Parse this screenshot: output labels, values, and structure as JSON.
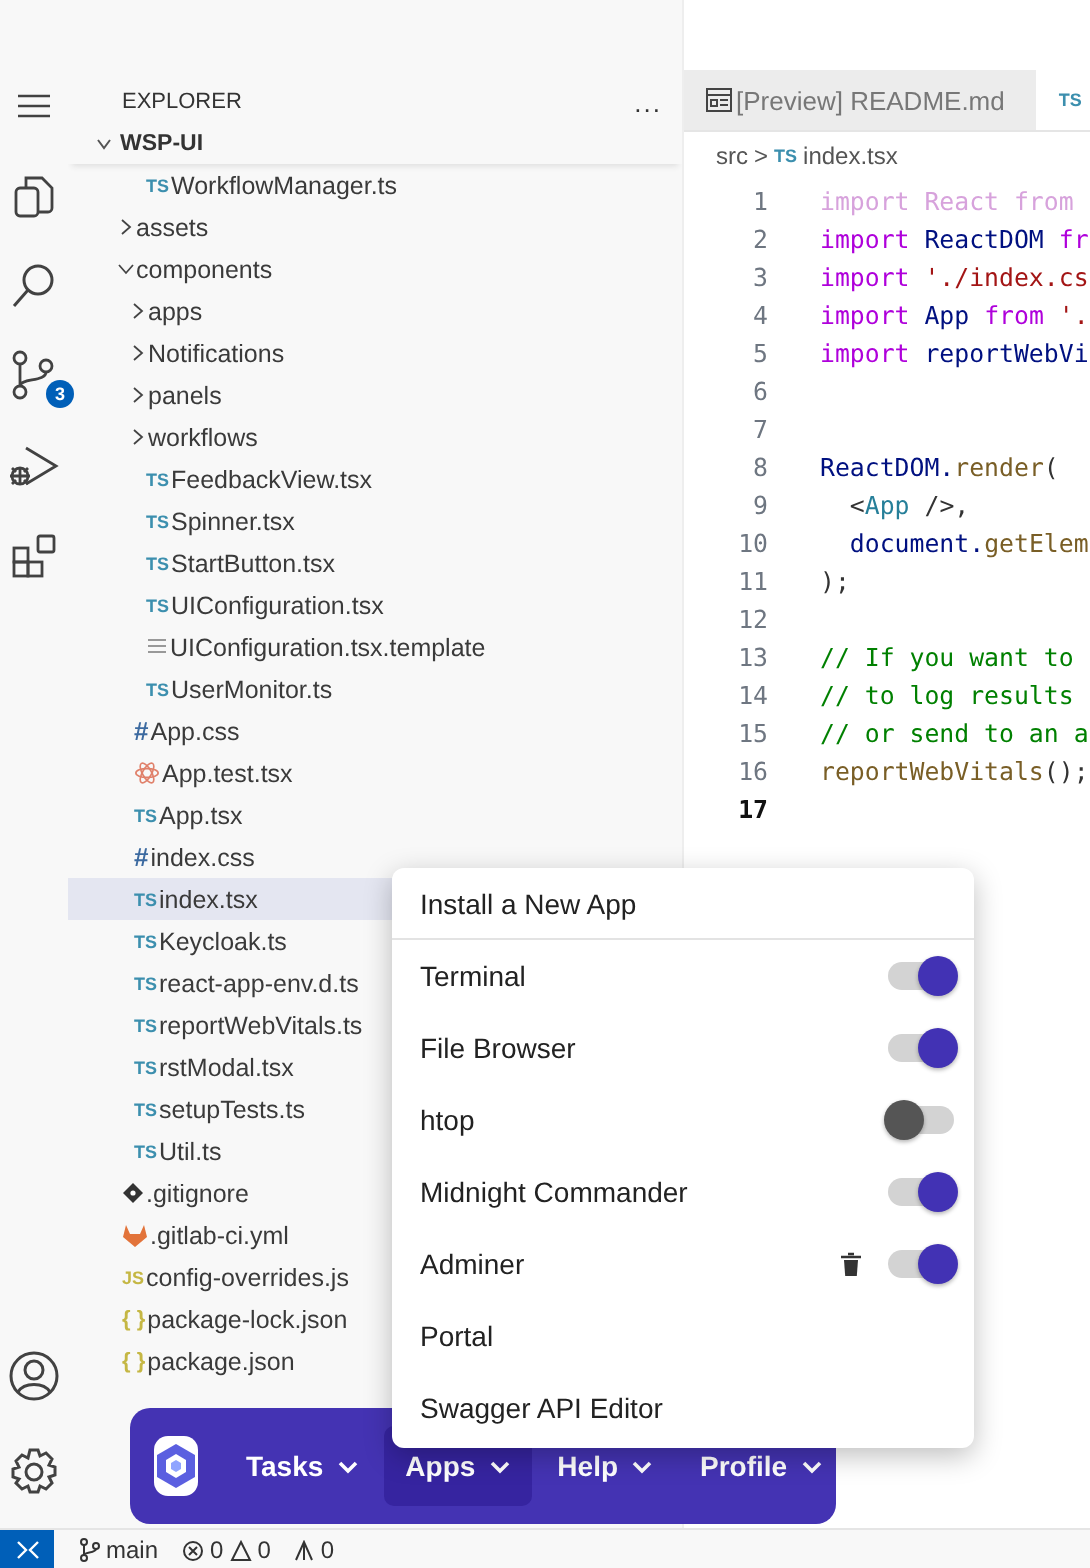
{
  "activity_bar": {
    "items": [
      {
        "kind": "menu"
      },
      {
        "kind": "files"
      },
      {
        "kind": "search"
      },
      {
        "kind": "source-control",
        "badge": "3"
      },
      {
        "kind": "debug"
      },
      {
        "kind": "extensions"
      }
    ],
    "bottom_items": [
      {
        "kind": "account"
      },
      {
        "kind": "settings"
      }
    ]
  },
  "sidebar": {
    "title": "EXPLORER",
    "more": "...",
    "root": {
      "label": "WSP-UI",
      "expanded": true
    },
    "tree": [
      {
        "children": [
          {
            "children": [
              {
                "label": "WorkflowManager.ts",
                "kind": "ts",
                "icon": "TS"
              }
            ]
          },
          {
            "label": "assets",
            "kind": "folder",
            "expanded": false
          },
          {
            "label": "components",
            "kind": "folder",
            "expanded": true,
            "children": [
              {
                "label": "apps",
                "kind": "folder",
                "expanded": false
              },
              {
                "label": "Notifications",
                "kind": "folder",
                "expanded": false
              },
              {
                "label": "panels",
                "kind": "folder",
                "expanded": false
              },
              {
                "label": "workflows",
                "kind": "folder",
                "expanded": false
              },
              {
                "label": "FeedbackView.tsx",
                "kind": "ts",
                "icon": "TS"
              },
              {
                "label": "Spinner.tsx",
                "kind": "ts",
                "icon": "TS"
              },
              {
                "label": "StartButton.tsx",
                "kind": "ts",
                "icon": "TS"
              },
              {
                "label": "UIConfiguration.tsx",
                "kind": "ts",
                "icon": "TS"
              },
              {
                "label": "UIConfiguration.tsx.template",
                "kind": "template"
              },
              {
                "label": "UserMonitor.ts",
                "kind": "ts",
                "icon": "TS"
              }
            ]
          },
          {
            "label": "App.css",
            "kind": "css",
            "icon": "#"
          },
          {
            "label": "App.test.tsx",
            "kind": "react"
          },
          {
            "label": "App.tsx",
            "kind": "ts",
            "icon": "TS"
          },
          {
            "label": "index.css",
            "kind": "css",
            "icon": "#"
          },
          {
            "label": "index.tsx",
            "kind": "ts",
            "icon": "TS",
            "selected": true
          },
          {
            "label": "Keycloak.ts",
            "kind": "ts",
            "icon": "TS"
          },
          {
            "label": "react-app-env.d.ts",
            "kind": "ts",
            "icon": "TS"
          },
          {
            "label": "reportWebVitals.ts",
            "kind": "ts",
            "icon": "TS"
          },
          {
            "label": "rstModal.tsx",
            "kind": "ts",
            "icon": "TS"
          },
          {
            "label": "setupTests.ts",
            "kind": "ts",
            "icon": "TS"
          },
          {
            "label": "Util.ts",
            "kind": "ts",
            "icon": "TS"
          }
        ]
      },
      {
        "label": ".gitignore",
        "kind": "git"
      },
      {
        "label": ".gitlab-ci.yml",
        "kind": "gitlab"
      },
      {
        "label": "config-overrides.js",
        "kind": "js",
        "icon": "JS"
      },
      {
        "label": "package-lock.json",
        "kind": "json",
        "icon": "{ }"
      },
      {
        "label": "package.json",
        "kind": "json",
        "icon": "{ }"
      }
    ]
  },
  "editor": {
    "tabs": [
      {
        "kind": "preview",
        "label": "[Preview] README.md",
        "selected": false
      },
      {
        "kind": "ts",
        "icon": "TS",
        "selected": true
      }
    ],
    "breadcrumb": {
      "folder": "src",
      "separator": ">",
      "file_icon": "TS",
      "file": "index.tsx"
    },
    "lines": [
      {
        "number": "1",
        "tokens": [
          {
            "kind": "faded",
            "text": "import React from"
          }
        ]
      },
      {
        "number": "2",
        "tokens": [
          {
            "kind": "kw",
            "text": "import "
          },
          {
            "kind": "id",
            "text": "ReactDOM "
          },
          {
            "kind": "kw",
            "text": "fr"
          }
        ]
      },
      {
        "number": "3",
        "tokens": [
          {
            "kind": "kw",
            "text": "import "
          },
          {
            "kind": "str",
            "text": "'./index.cs"
          }
        ]
      },
      {
        "number": "4",
        "tokens": [
          {
            "kind": "kw",
            "text": "import "
          },
          {
            "kind": "id",
            "text": "App "
          },
          {
            "kind": "kw",
            "text": "from "
          },
          {
            "kind": "str",
            "text": "'."
          }
        ]
      },
      {
        "number": "5",
        "tokens": [
          {
            "kind": "kw",
            "text": "import "
          },
          {
            "kind": "id",
            "text": "reportWebVi"
          }
        ]
      },
      {
        "number": "6"
      },
      {
        "number": "7"
      },
      {
        "number": "8",
        "tokens": [
          {
            "kind": "id",
            "text": "ReactDOM."
          },
          {
            "kind": "fn",
            "text": "render"
          },
          {
            "kind": "pun",
            "text": "("
          }
        ]
      },
      {
        "number": "9",
        "tokens": [
          {
            "kind": "pun",
            "text": "  <"
          },
          {
            "kind": "cls",
            "text": "App"
          },
          {
            "kind": "pun",
            "text": " />,"
          }
        ]
      },
      {
        "number": "10",
        "tokens": [
          {
            "kind": "id",
            "text": "  document."
          },
          {
            "kind": "fn",
            "text": "getElem"
          }
        ]
      },
      {
        "number": "11",
        "tokens": [
          {
            "kind": "pun",
            "text": ");"
          }
        ]
      },
      {
        "number": "12"
      },
      {
        "number": "13",
        "tokens": [
          {
            "kind": "cm",
            "text": "// If you want to"
          }
        ]
      },
      {
        "number": "14",
        "tokens": [
          {
            "kind": "cm",
            "text": "// to log results"
          }
        ]
      },
      {
        "number": "15",
        "tokens": [
          {
            "kind": "cm",
            "text": "// or send to an a"
          }
        ]
      },
      {
        "number": "16",
        "tokens": [
          {
            "kind": "fn",
            "text": "reportWebVitals"
          },
          {
            "kind": "pun",
            "text": "();"
          }
        ]
      },
      {
        "number": "17",
        "current": true
      }
    ]
  },
  "apps_menu": {
    "items": [
      {
        "kind": "action",
        "label": "Install a New App"
      },
      {
        "kind": "toggle",
        "label": "Terminal",
        "on": true
      },
      {
        "kind": "toggle",
        "label": "File Browser",
        "on": true
      },
      {
        "kind": "toggle",
        "label": "htop",
        "on": false
      },
      {
        "kind": "toggle",
        "label": "Midnight Commander",
        "on": true
      },
      {
        "kind": "toggle",
        "label": "Adminer",
        "on": true,
        "deletable": true
      },
      {
        "kind": "plain",
        "label": "Portal"
      },
      {
        "kind": "plain",
        "label": "Swagger API Editor"
      }
    ]
  },
  "app_bar": {
    "menus": [
      {
        "label": "Tasks",
        "selected": false
      },
      {
        "label": "Apps",
        "selected": true
      },
      {
        "label": "Help",
        "selected": false
      },
      {
        "label": "Profile",
        "selected": false
      }
    ]
  },
  "status_bar": {
    "branch": "main",
    "errors": "0",
    "warnings": "0",
    "ports": "0"
  }
}
